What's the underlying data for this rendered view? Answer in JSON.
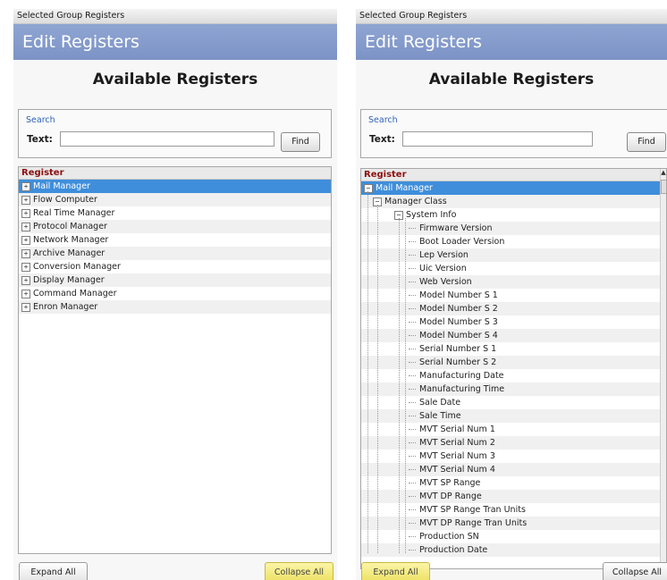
{
  "colors": {
    "header_band": "#7c93c6",
    "selected_row": "#3f8edb",
    "column_header_text": "#8b1010",
    "search_legend": "#2e63b8",
    "collapse_highlight": "#ece05f"
  },
  "left": {
    "window_title": "Selected Group Registers",
    "header": "Edit Registers",
    "section_title": "Available Registers",
    "search": {
      "legend": "Search",
      "label": "Text:",
      "value": "",
      "find_label": "Find"
    },
    "column_header": "Register",
    "items": [
      {
        "label": "Mail Manager",
        "toggle": "+",
        "selected": true
      },
      {
        "label": "Flow Computer",
        "toggle": "+"
      },
      {
        "label": "Real Time Manager",
        "toggle": "+"
      },
      {
        "label": "Protocol Manager",
        "toggle": "+"
      },
      {
        "label": "Network Manager",
        "toggle": "+"
      },
      {
        "label": "Archive Manager",
        "toggle": "+"
      },
      {
        "label": "Conversion Manager",
        "toggle": "+"
      },
      {
        "label": "Display Manager",
        "toggle": "+"
      },
      {
        "label": "Command Manager",
        "toggle": "+"
      },
      {
        "label": "Enron Manager",
        "toggle": "+"
      }
    ],
    "expand_all": "Expand All",
    "collapse_all": "Collapse All",
    "highlighted_button": "collapse"
  },
  "right": {
    "window_title": "Selected Group Registers",
    "header": "Edit Registers",
    "section_title": "Available Registers",
    "search": {
      "legend": "Search",
      "label": "Text:",
      "value": "",
      "find_label": "Find"
    },
    "column_header": "Register",
    "items": [
      {
        "label": "Mail Manager",
        "level": 0,
        "toggle": "−",
        "selected": true
      },
      {
        "label": "Manager Class",
        "level": 1,
        "toggle": "−"
      },
      {
        "label": "System Info",
        "level": 2,
        "toggle": "−"
      },
      {
        "label": "Firmware Version",
        "level": 3
      },
      {
        "label": "Boot Loader Version",
        "level": 3
      },
      {
        "label": "Lep Version",
        "level": 3
      },
      {
        "label": "Uic Version",
        "level": 3
      },
      {
        "label": "Web Version",
        "level": 3
      },
      {
        "label": "Model Number S 1",
        "level": 3
      },
      {
        "label": "Model Number S 2",
        "level": 3
      },
      {
        "label": "Model Number S 3",
        "level": 3
      },
      {
        "label": "Model Number S 4",
        "level": 3
      },
      {
        "label": "Serial Number S 1",
        "level": 3
      },
      {
        "label": "Serial Number S 2",
        "level": 3
      },
      {
        "label": "Manufacturing Date",
        "level": 3
      },
      {
        "label": "Manufacturing Time",
        "level": 3
      },
      {
        "label": "Sale Date",
        "level": 3
      },
      {
        "label": "Sale Time",
        "level": 3
      },
      {
        "label": "MVT Serial Num 1",
        "level": 3
      },
      {
        "label": "MVT Serial Num 2",
        "level": 3
      },
      {
        "label": "MVT Serial Num 3",
        "level": 3
      },
      {
        "label": "MVT Serial Num 4",
        "level": 3
      },
      {
        "label": "MVT SP Range",
        "level": 3
      },
      {
        "label": "MVT DP Range",
        "level": 3
      },
      {
        "label": "MVT SP Range Tran Units",
        "level": 3
      },
      {
        "label": "MVT DP Range Tran Units",
        "level": 3
      },
      {
        "label": "Production SN",
        "level": 3
      },
      {
        "label": "Production Date",
        "level": 3
      }
    ],
    "expand_all": "Expand All",
    "collapse_all": "Collapse All",
    "highlighted_button": "expand"
  }
}
